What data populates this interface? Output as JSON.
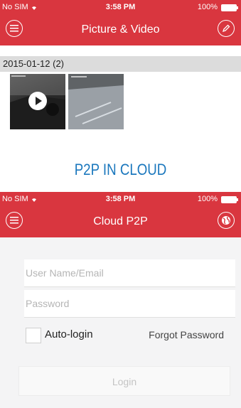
{
  "screen1": {
    "status": {
      "carrier": "No SIM",
      "time": "3:58 PM",
      "battery": "100%"
    },
    "nav": {
      "title": "Picture & Video",
      "left_icon": "menu-icon",
      "right_icon": "edit-icon"
    },
    "date_group": "2015-01-12 (2)"
  },
  "section_heading": "P2P IN CLOUD",
  "screen2": {
    "status": {
      "carrier": "No SIM",
      "time": "3:58 PM",
      "battery": "100%"
    },
    "nav": {
      "title": "Cloud P2P",
      "left_icon": "menu-icon",
      "right_icon": "globe-icon"
    },
    "form": {
      "username_placeholder": "User Name/Email",
      "password_placeholder": "Password",
      "autologin_label": "Auto-login",
      "forgot_label": "Forgot Password",
      "login_label": "Login"
    }
  },
  "colors": {
    "accent": "#d9363f",
    "heading": "#1a77bd"
  }
}
